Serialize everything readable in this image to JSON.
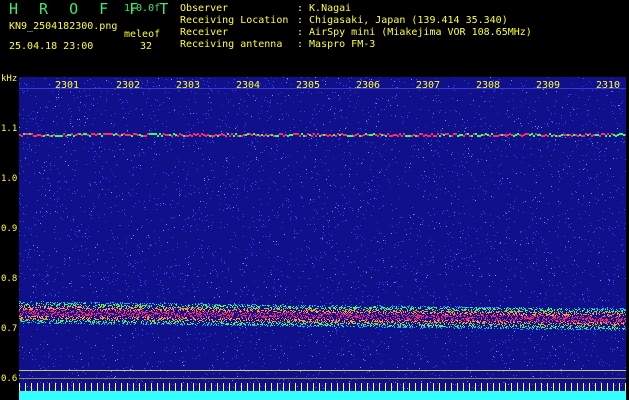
{
  "header": {
    "app_title": "H R O F F T",
    "version": "1.0.0f",
    "filename": "KN9_2504182300.png",
    "mode": "meleof",
    "datetime": "25.04.18 23:00",
    "count": "32",
    "info": [
      {
        "label": "Observer",
        "value": ": K.Nagai"
      },
      {
        "label": "Receiving Location",
        "value": ": Chigasaki, Japan (139.414 35.340)"
      },
      {
        "label": "Receiver",
        "value": ": AirSpy mini (Miakejima VOR 108.65MHz)"
      },
      {
        "label": "Receiving antenna",
        "value": ": Maspro FM-3"
      }
    ]
  },
  "spectrogram": {
    "y_unit": "kHz",
    "y_ticks": [
      "1.1",
      "1.0",
      "0.9",
      "0.8",
      "0.7",
      "0.6"
    ],
    "x_ticks": [
      "2301",
      "2302",
      "2303",
      "2304",
      "2305",
      "2306",
      "2307",
      "2308",
      "2309",
      "2310"
    ],
    "colors": {
      "background": "#10108a",
      "noise": "#2a4cff",
      "signal": "#ff2a6a",
      "mid": "#33ff66",
      "base": "#33ffff"
    }
  }
}
